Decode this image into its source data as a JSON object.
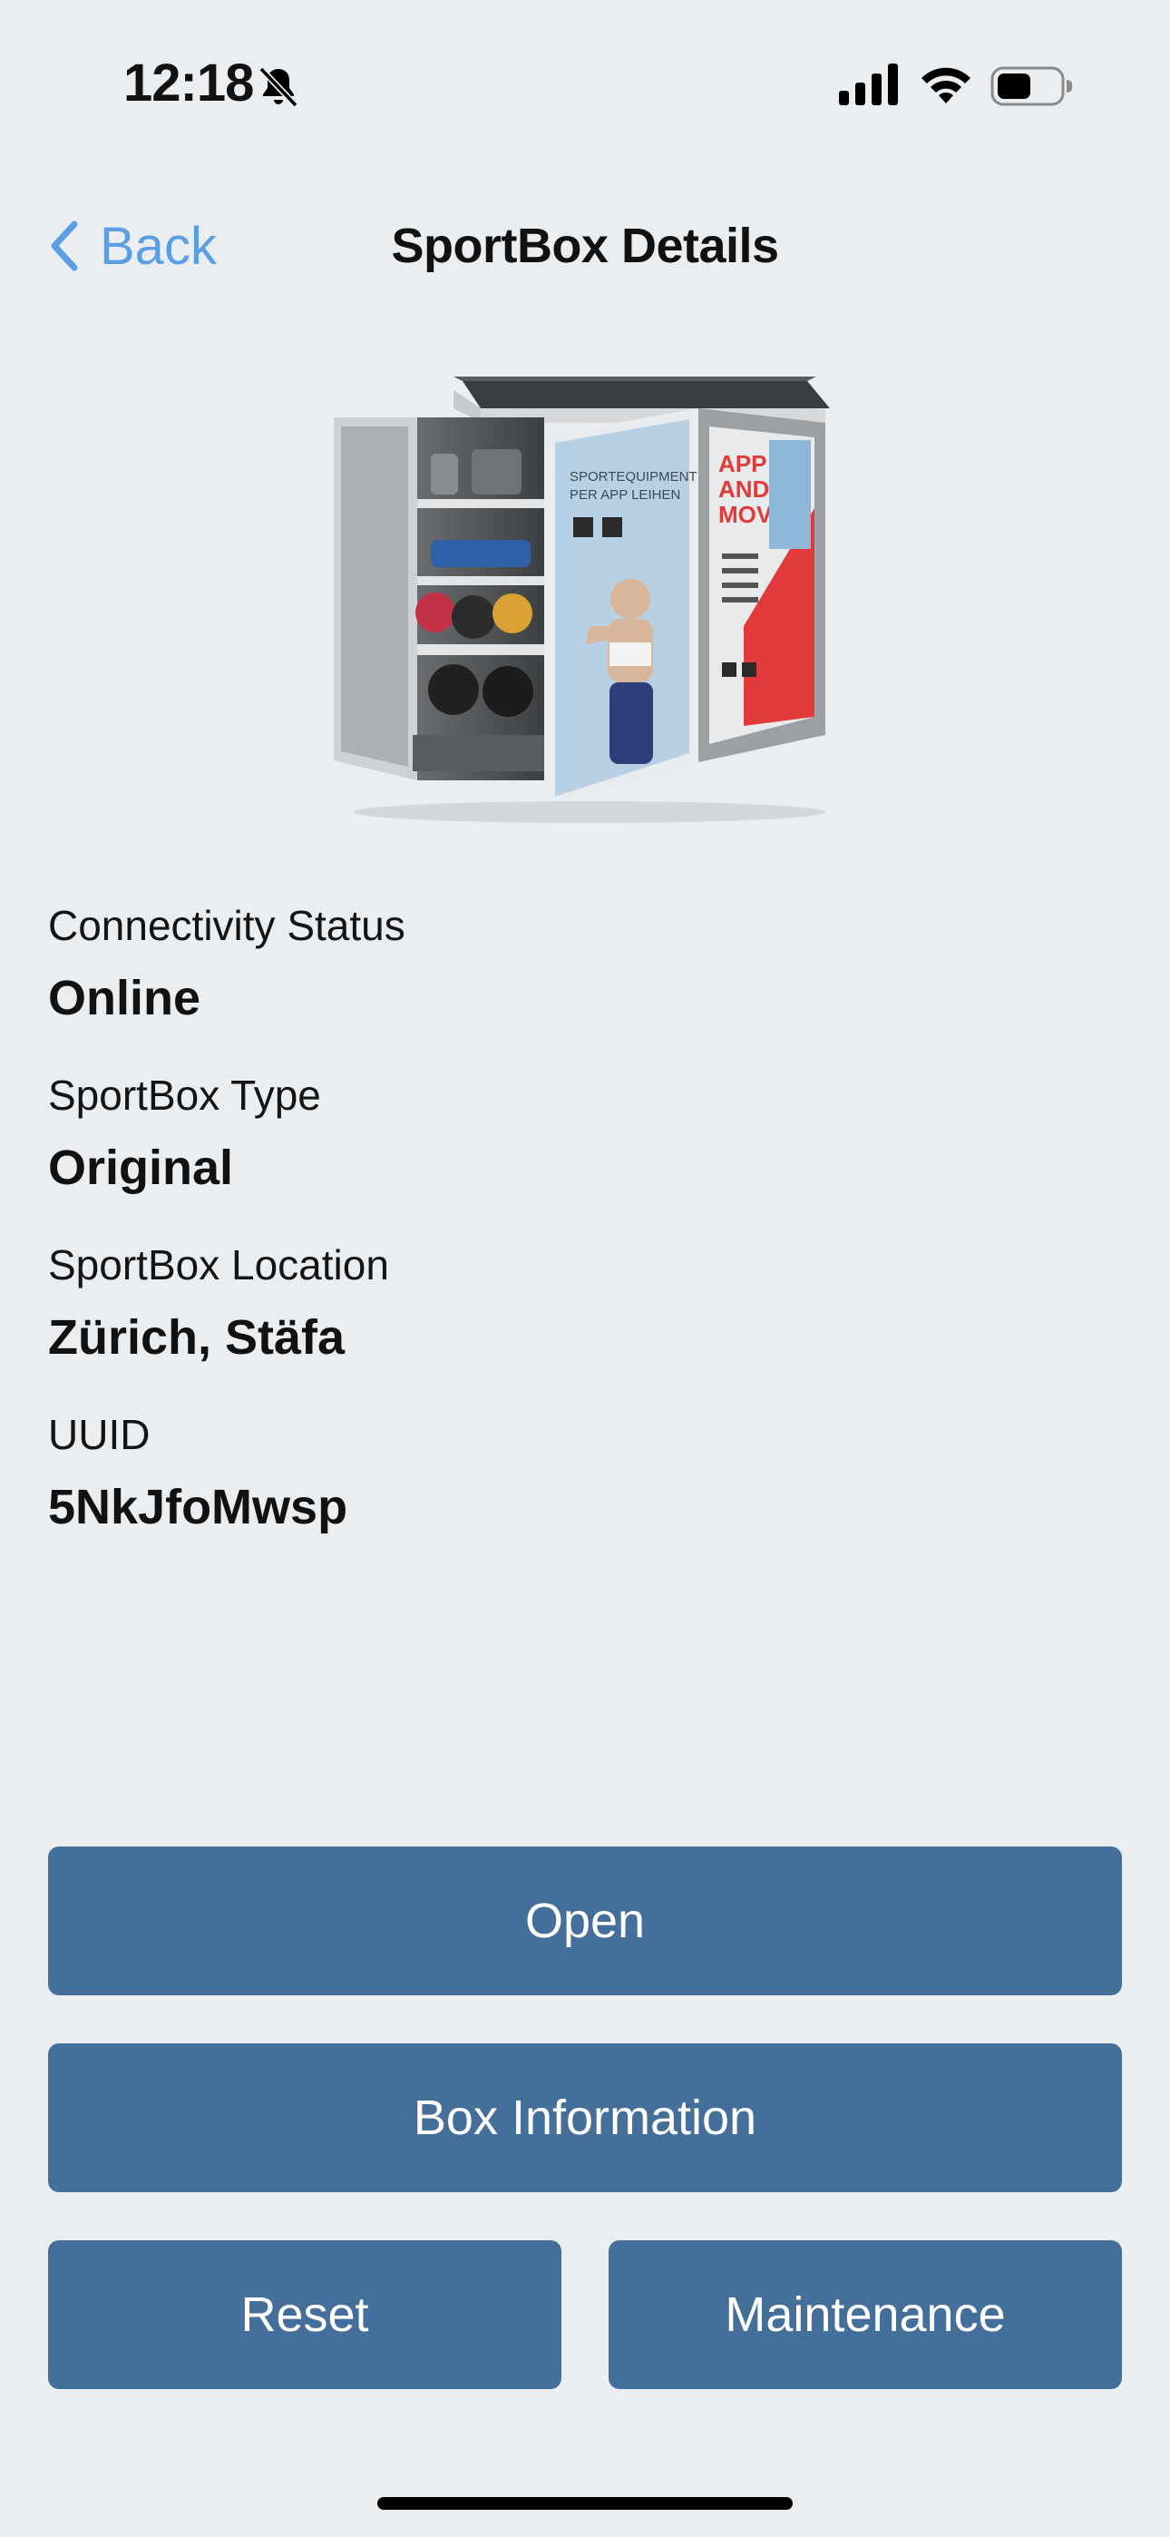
{
  "status_bar": {
    "time": "12:18",
    "icons": [
      "bell-slash-icon",
      "cellular-signal-icon",
      "wifi-icon",
      "battery-icon"
    ]
  },
  "nav": {
    "back_label": "Back",
    "title": "SportBox Details"
  },
  "product_image": {
    "description_icon": "sportbox-cabinet-image",
    "poster_text_1": "SPORTEQUIPMENT PER APP LEIHEN",
    "poster_text_2": "APP AND MOVE"
  },
  "details": [
    {
      "label": "Connectivity Status",
      "value": "Online"
    },
    {
      "label": "SportBox Type",
      "value": "Original"
    },
    {
      "label": "SportBox Location",
      "value": "Zürich, Stäfa"
    },
    {
      "label": "UUID",
      "value": "5NkJfoMwsp"
    }
  ],
  "buttons": {
    "open": "Open",
    "box_information": "Box Information",
    "reset": "Reset",
    "maintenance": "Maintenance"
  },
  "colors": {
    "background": "#ebeef1",
    "button": "#446f9a",
    "link": "#5a9ee6"
  }
}
